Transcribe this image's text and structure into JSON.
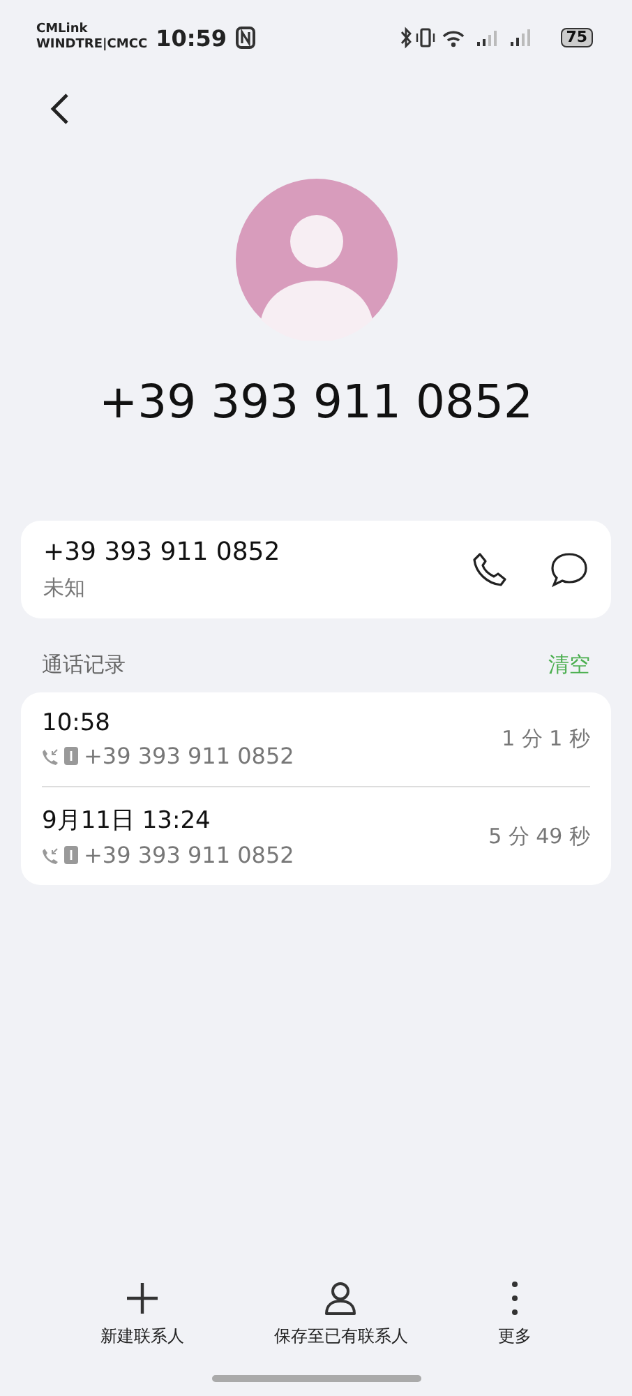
{
  "status_bar": {
    "carriers": [
      "CMLink",
      "WINDTRE|CMCC"
    ],
    "time": "10:59",
    "battery": "75"
  },
  "contact": {
    "title": "+39 393 911 0852"
  },
  "number_card": {
    "number": "+39 393 911 0852",
    "label": "未知"
  },
  "call_log": {
    "title": "通话记录",
    "clear": "清空",
    "entries": [
      {
        "time": "10:58",
        "number": "+39 393 911 0852",
        "duration": "1 分 1 秒"
      },
      {
        "time": "9月11日 13:24",
        "number": "+39 393 911 0852",
        "duration": "5 分 49 秒"
      }
    ]
  },
  "actions": [
    {
      "kind": "add",
      "label": "新建联系人"
    },
    {
      "kind": "person",
      "label": "保存至已有联系人"
    },
    {
      "kind": "more",
      "label": "更多"
    }
  ]
}
